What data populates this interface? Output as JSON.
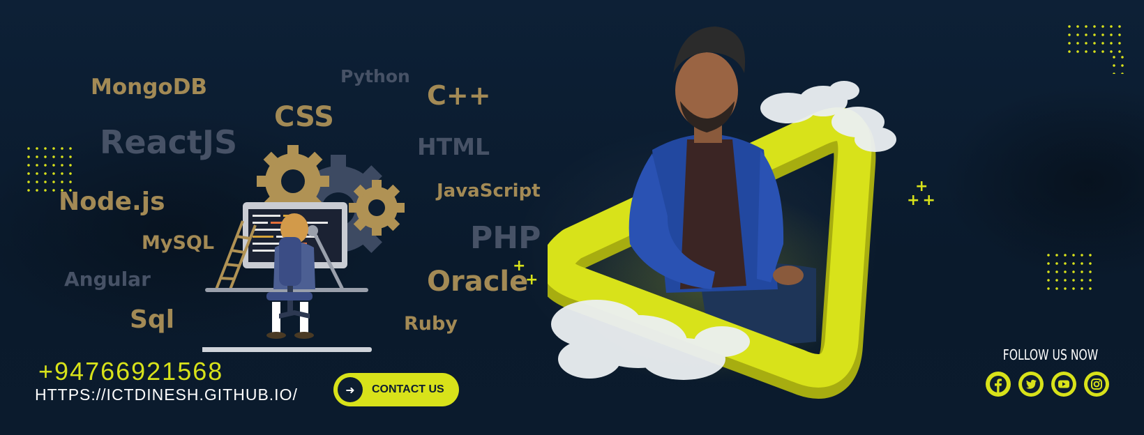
{
  "tech_words": {
    "mongodb": "MongoDB",
    "python": "Python",
    "cpp": "C++",
    "css": "CSS",
    "reactjs": "ReactJS",
    "html": "HTML",
    "javascript": "JavaScript",
    "nodejs": "Node.js",
    "php": "PHP",
    "mysql": "MySQL",
    "angular": "Angular",
    "oracle": "Oracle",
    "sql": "Sql",
    "ruby": "Ruby"
  },
  "contact": {
    "phone": "+94766921568",
    "url": "HTTPS://ICTDINESH.GITHUB.IO/",
    "button_label": "CONTACT US"
  },
  "follow": {
    "heading": "FOLLOW US NOW",
    "icons": [
      "facebook-icon",
      "twitter-icon",
      "youtube-icon",
      "instagram-icon"
    ]
  },
  "colors": {
    "accent": "#d8e21a",
    "background": "#0b1a2b",
    "gold_text": "#a38a55",
    "slate_text": "#475266"
  }
}
